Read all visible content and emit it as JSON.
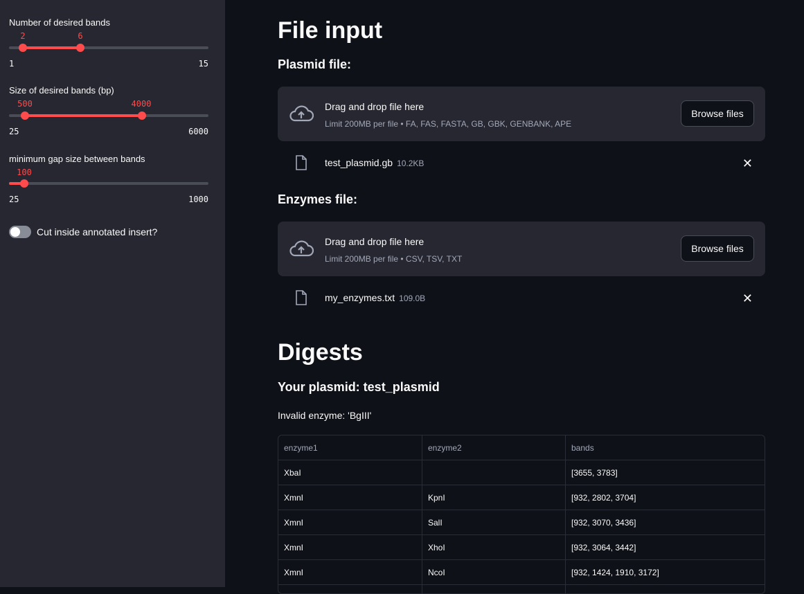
{
  "sidebar": {
    "bands": {
      "label": "Number of desired bands",
      "min": "1",
      "max": "15",
      "low": "2",
      "high": "6",
      "low_fraction": 0.071,
      "high_fraction": 0.357
    },
    "size": {
      "label": "Size of desired bands (bp)",
      "min": "25",
      "max": "6000",
      "low": "500",
      "high": "4000",
      "low_fraction": 0.079,
      "high_fraction": 0.665
    },
    "gap": {
      "label": "minimum gap size between bands",
      "min": "25",
      "max": "1000",
      "value": "100",
      "fraction": 0.077
    },
    "toggle": {
      "label": "Cut inside annotated insert?",
      "checked": false
    }
  },
  "main": {
    "file_input_title": "File input",
    "plasmid": {
      "title": "Plasmid file:",
      "drop_text": "Drag and drop file here",
      "limit": "Limit 200MB per file • FA, FAS, FASTA, GB, GBK, GENBANK, APE",
      "browse": "Browse files",
      "file_name": "test_plasmid.gb",
      "file_size": "10.2KB"
    },
    "enzymes": {
      "title": "Enzymes file:",
      "drop_text": "Drag and drop file here",
      "limit": "Limit 200MB per file • CSV, TSV, TXT",
      "browse": "Browse files",
      "file_name": "my_enzymes.txt",
      "file_size": "109.0B"
    },
    "digests_title": "Digests",
    "plasmid_heading": "Your plasmid: test_plasmid",
    "invalid_msg": "Invalid enzyme: 'BgIII'",
    "table": {
      "headers": [
        "enzyme1",
        "enzyme2",
        "bands"
      ],
      "rows": [
        [
          "XbaI",
          "",
          "[3655, 3783]"
        ],
        [
          "XmnI",
          "KpnI",
          "[932, 2802, 3704]"
        ],
        [
          "XmnI",
          "SalI",
          "[932, 3070, 3436]"
        ],
        [
          "XmnI",
          "XhoI",
          "[932, 3064, 3442]"
        ],
        [
          "XmnI",
          "NcoI",
          "[932, 1424, 1910, 3172]"
        ],
        [
          "",
          "",
          ""
        ]
      ]
    }
  },
  "colors": {
    "accent": "#ff4b4b",
    "bg": "#0e1117",
    "sidebar": "#262730"
  }
}
